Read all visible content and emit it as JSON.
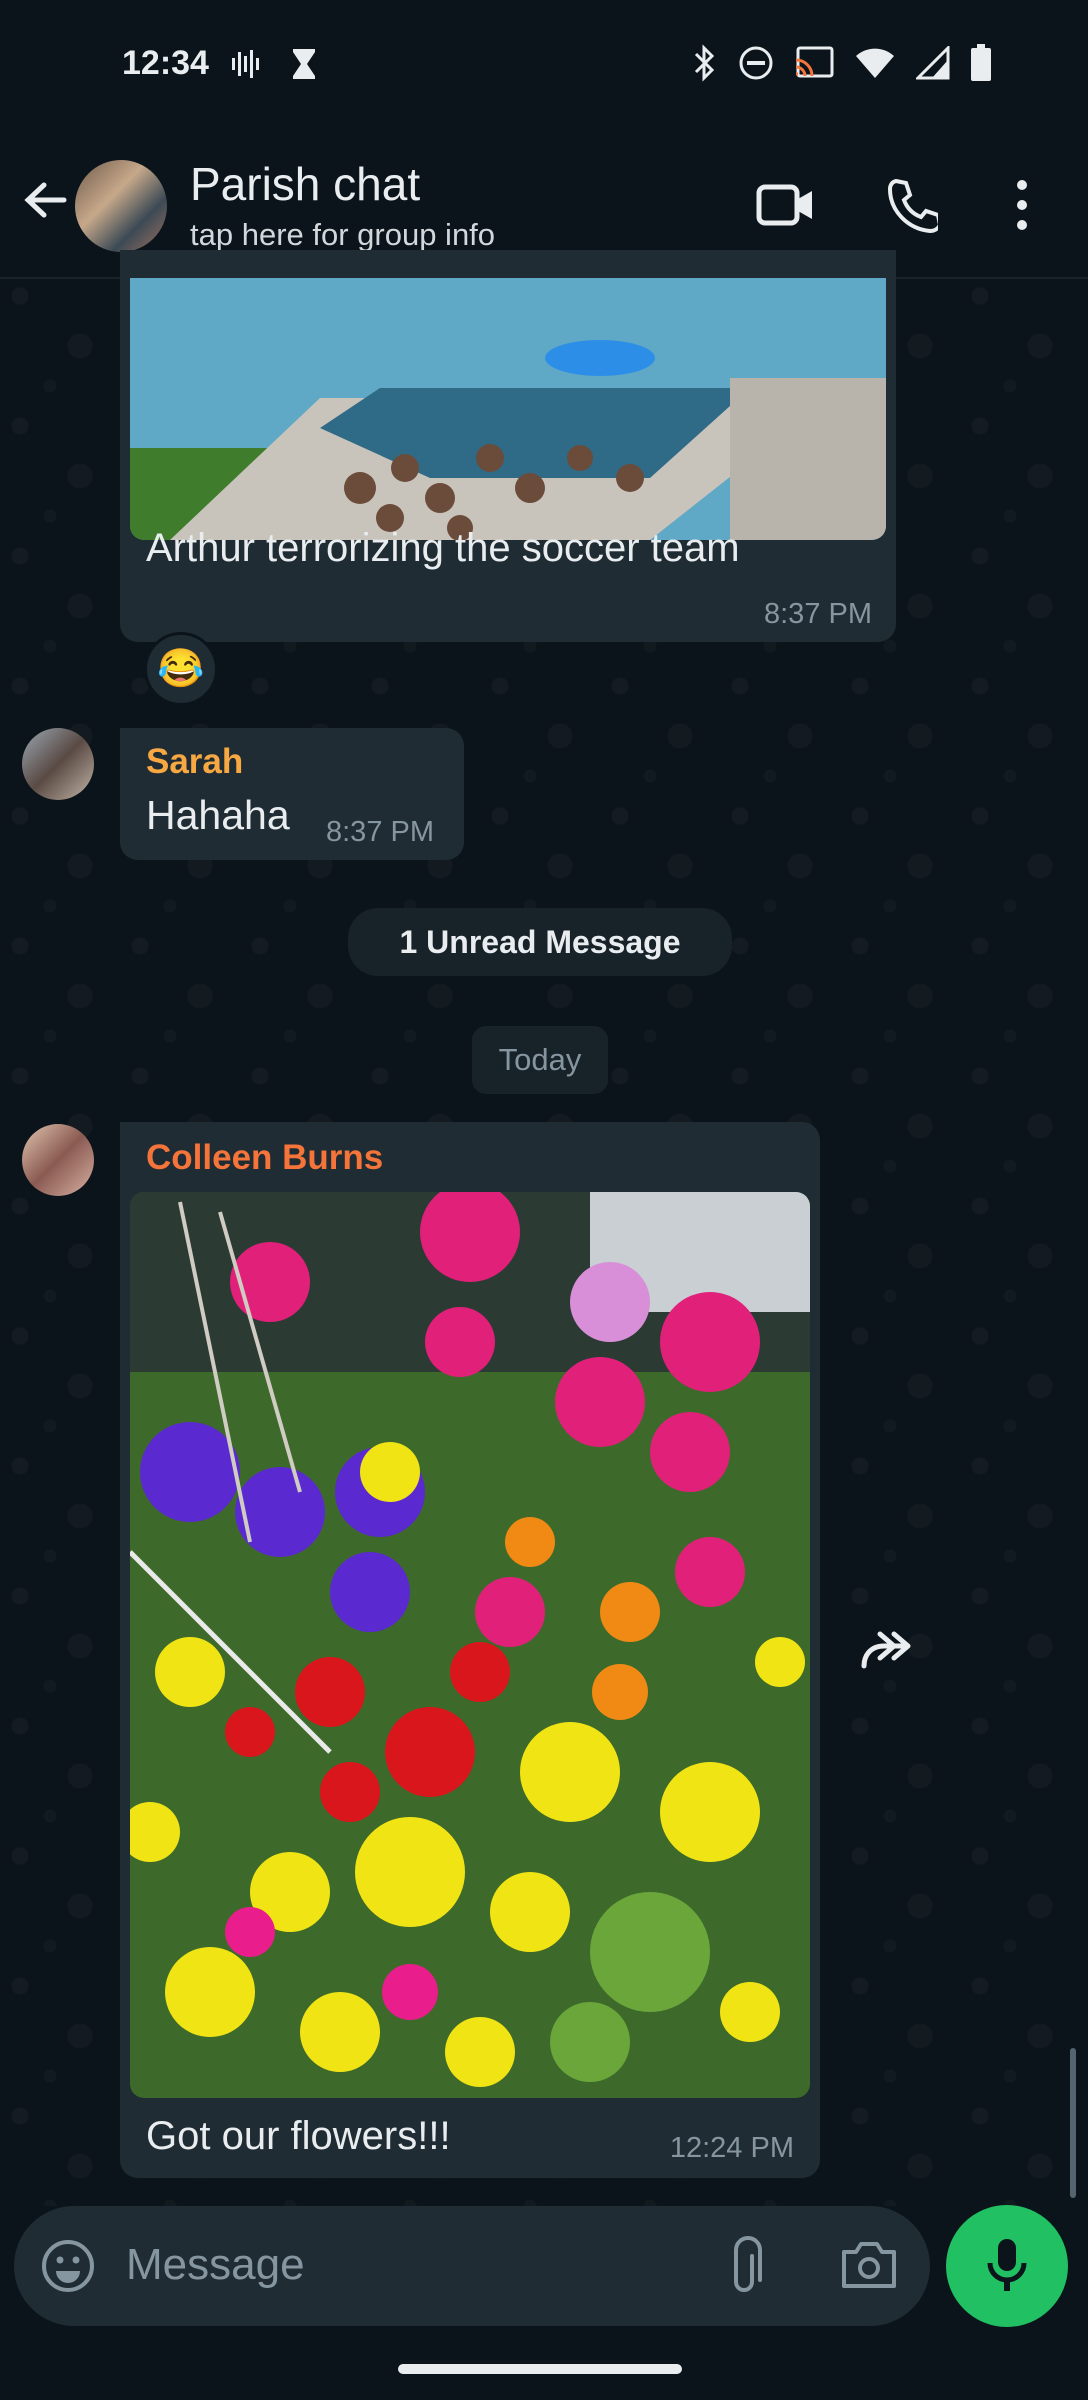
{
  "status_bar": {
    "time": "12:34"
  },
  "header": {
    "title": "Parish chat",
    "subtitle": "tap here for group info"
  },
  "messages": [
    {
      "type": "image",
      "caption": "Arthur terrorizing the soccer team",
      "time": "8:37 PM",
      "reaction": "😂"
    },
    {
      "type": "text",
      "sender": "Sarah",
      "sender_color": "#f7a843",
      "text": "Hahaha",
      "time": "8:37 PM"
    },
    {
      "type": "image",
      "sender": "Colleen Burns",
      "sender_color": "#f4743a",
      "caption": "Got our flowers!!!",
      "time": "12:24 PM"
    }
  ],
  "unread_banner": "1 Unread Message",
  "date_separator": "Today",
  "composer": {
    "placeholder": "Message"
  },
  "colors": {
    "accent": "#21c063",
    "bubble": "#202c33",
    "background": "#0b141a"
  },
  "icons": [
    "back-arrow-icon",
    "video-call-icon",
    "phone-call-icon",
    "more-vert-icon",
    "emoji-icon",
    "attach-icon",
    "camera-icon",
    "mic-icon",
    "forward-icon"
  ]
}
